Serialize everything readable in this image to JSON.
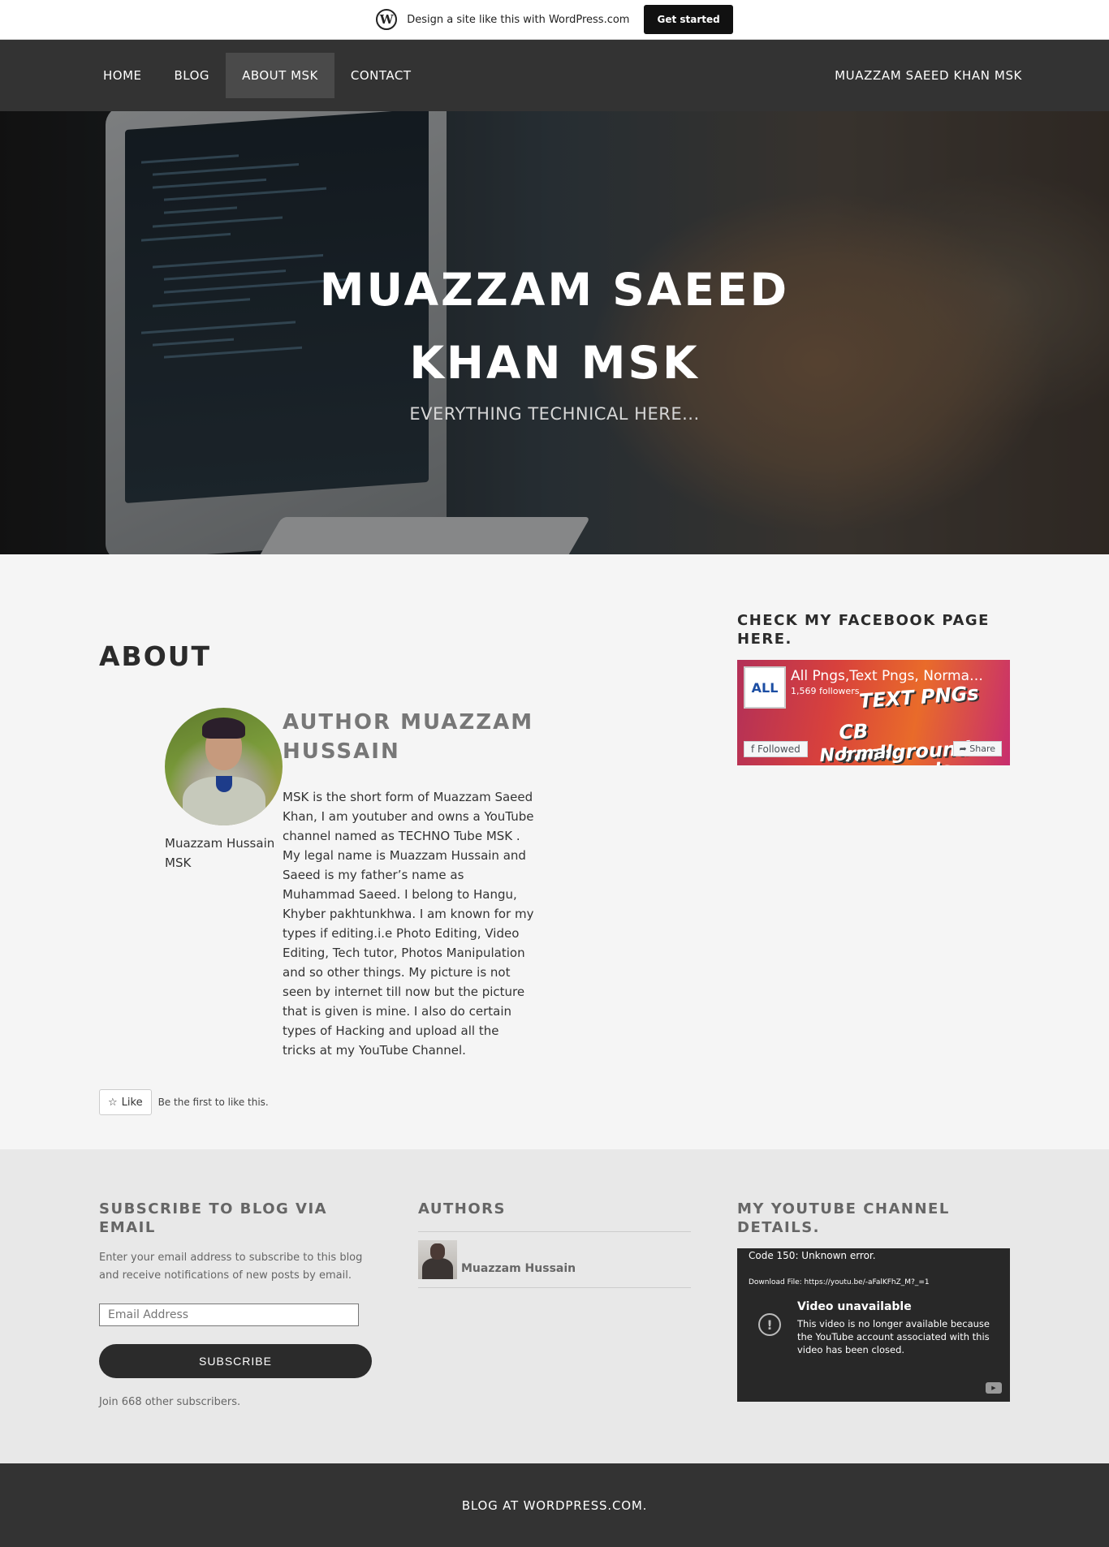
{
  "promo": {
    "text": "Design a site like this with WordPress.com",
    "button": "Get started"
  },
  "nav": {
    "items": [
      {
        "label": "HOME"
      },
      {
        "label": "BLOG"
      },
      {
        "label": "ABOUT MSK"
      },
      {
        "label": "CONTACT"
      }
    ],
    "active": "ABOUT MSK",
    "site_title": "MUAZZAM SAEED KHAN MSK"
  },
  "hero": {
    "title_line1": "MUAZZAM SAEED",
    "title_line2": "KHAN MSK",
    "tagline": "EVERYTHING TECHNICAL HERE..."
  },
  "page": {
    "title": "ABOUT",
    "author": {
      "caption_line1": "Muazzam Hussain",
      "caption_line2": "MSK",
      "heading_line1": "AUTHOR MUAZZAM",
      "heading_line2": "HUSSAIN",
      "bio": "MSK is the short form of Muazzam Saeed Khan, I am youtuber and owns a YouTube channel named as TECHNO Tube MSK . My legal name is Muazzam Hussain and Saeed is my father’s name as Muhammad Saeed. I belong to Hangu, Khyber pakhtunkhwa. I am known for my types if editing.i.e Photo Editing, Video Editing, Tech tutor, Photos Manipulation and so other things. My picture is not seen by internet till now but the picture that is given is mine. I also do certain types of Hacking and upload all the tricks at my YouTube Channel."
    },
    "like": {
      "button": "Like",
      "note": "Be the first to like this."
    }
  },
  "sidebar": {
    "facebook_title": "CHECK MY FACEBOOK PAGE HERE.",
    "facebook": {
      "logo_text": "ALL",
      "page_name": "All Pngs,Text Pngs, Norma…",
      "followers": "1,569 followers",
      "cover_text_1": "TEXT PNGs",
      "cover_text_2": "CB backgrounds",
      "cover_text_3": "Normal Backgrounds",
      "followed_button": "Followed",
      "share_button": "Share"
    }
  },
  "footer": {
    "subscribe": {
      "title": "SUBSCRIBE TO BLOG VIA EMAIL",
      "description": "Enter your email address to subscribe to this blog and receive notifications of new posts by email.",
      "email_placeholder": "Email Address",
      "button": "SUBSCRIBE",
      "join_note": "Join 668 other subscribers."
    },
    "authors": {
      "title": "AUTHORS",
      "items": [
        {
          "name": "Muazzam Hussain"
        }
      ]
    },
    "youtube": {
      "title": "MY YOUTUBE CHANNEL DETAILS.",
      "error_code": "Code 150: Unknown error.",
      "download": "Download File: https://youtu.be/-aFalKFhZ_M?_=1",
      "unavailable": "Video unavailable",
      "message": "This video is no longer available because the YouTube account associated with this video has been closed."
    },
    "credit": "BLOG AT WORDPRESS.COM."
  },
  "colors": {
    "nav_bg": "#333333",
    "nav_active_bg": "#4a4a4a",
    "page_bg": "#f5f5f5",
    "footer_widgets_bg": "#e8e8e8",
    "accent_dark": "#2b2b2b"
  },
  "icons": [
    "wordpress-logo-icon",
    "star-icon",
    "facebook-icon",
    "share-icon",
    "alert-circle-icon",
    "youtube-icon"
  ]
}
